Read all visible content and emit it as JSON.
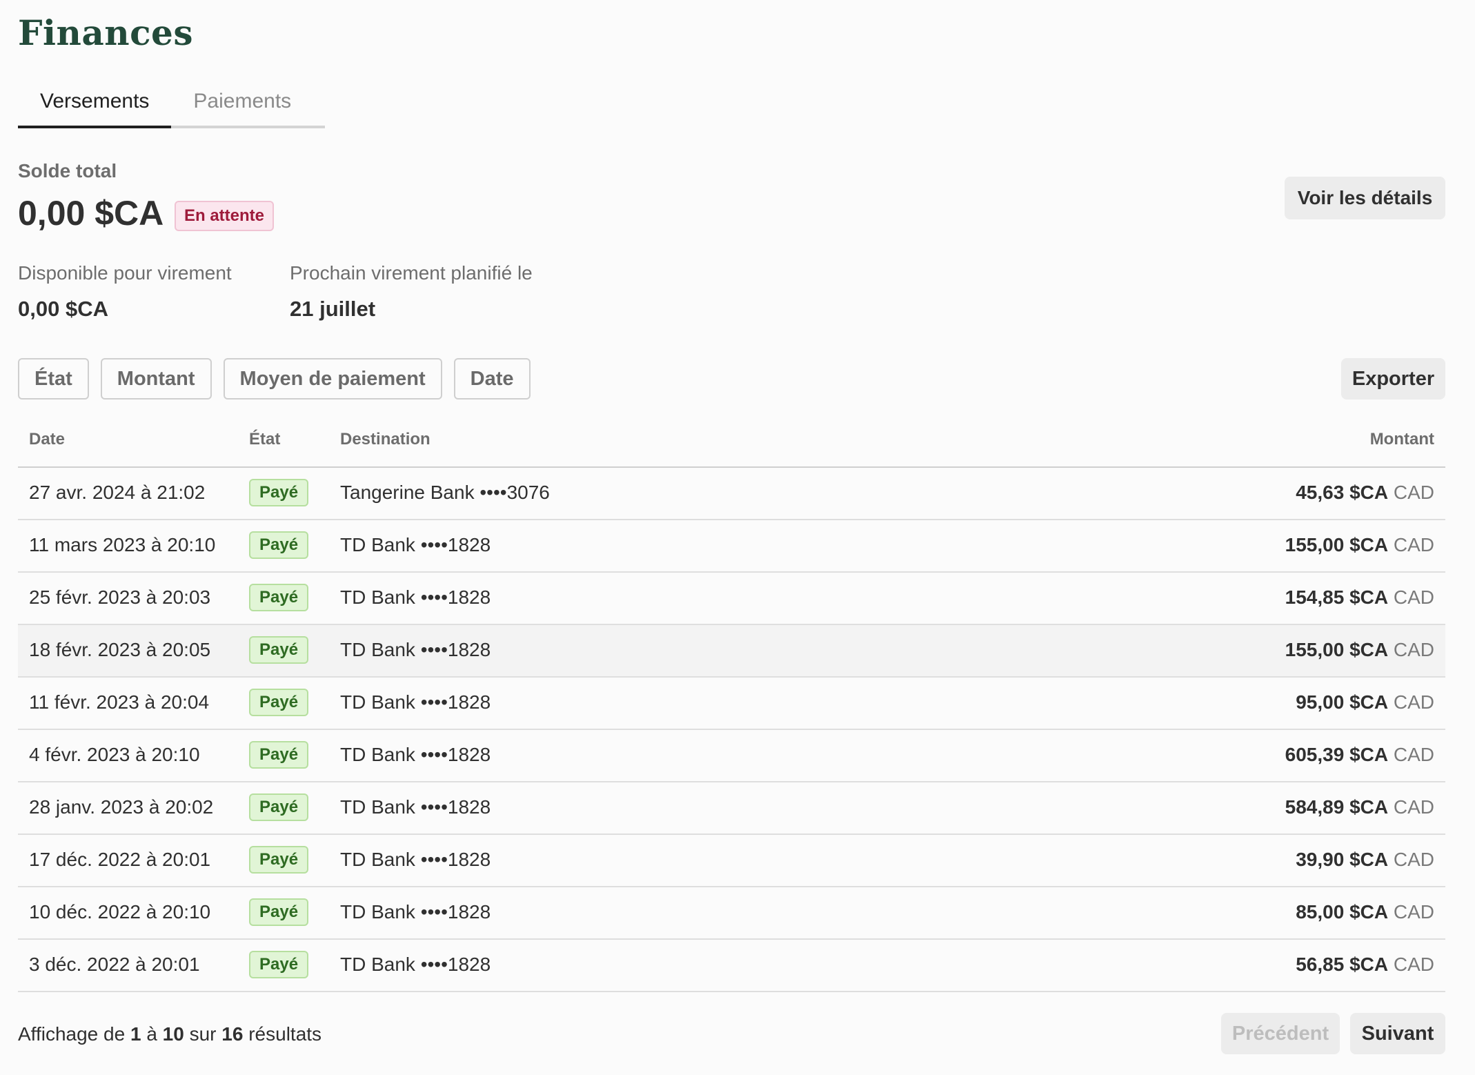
{
  "page_title": "Finances",
  "tabs": [
    {
      "label": "Versements",
      "active": true
    },
    {
      "label": "Paiements",
      "active": false
    }
  ],
  "balance": {
    "label": "Solde total",
    "value": "0,00 $CA",
    "status": "En attente",
    "details_button": "Voir les détails"
  },
  "stats": {
    "available_label": "Disponible pour virement",
    "available_value": "0,00 $CA",
    "next_label": "Prochain virement planifié le",
    "next_value": "21 juillet"
  },
  "filters": [
    "État",
    "Montant",
    "Moyen de paiement",
    "Date"
  ],
  "export_label": "Exporter",
  "table": {
    "columns": {
      "date": "Date",
      "status": "État",
      "destination": "Destination",
      "amount": "Montant"
    },
    "rows": [
      {
        "date": "27 avr. 2024 à 21:02",
        "status": "Payé",
        "destination": "Tangerine Bank ••••3076",
        "amount": "45,63 $CA",
        "currency": "CAD"
      },
      {
        "date": "11 mars 2023 à 20:10",
        "status": "Payé",
        "destination": "TD Bank ••••1828",
        "amount": "155,00 $CA",
        "currency": "CAD"
      },
      {
        "date": "25 févr. 2023 à 20:03",
        "status": "Payé",
        "destination": "TD Bank ••••1828",
        "amount": "154,85 $CA",
        "currency": "CAD"
      },
      {
        "date": "18 févr. 2023 à 20:05",
        "status": "Payé",
        "destination": "TD Bank ••••1828",
        "amount": "155,00 $CA",
        "currency": "CAD"
      },
      {
        "date": "11 févr. 2023 à 20:04",
        "status": "Payé",
        "destination": "TD Bank ••••1828",
        "amount": "95,00 $CA",
        "currency": "CAD"
      },
      {
        "date": "4 févr. 2023 à 20:10",
        "status": "Payé",
        "destination": "TD Bank ••••1828",
        "amount": "605,39 $CA",
        "currency": "CAD"
      },
      {
        "date": "28 janv. 2023 à 20:02",
        "status": "Payé",
        "destination": "TD Bank ••••1828",
        "amount": "584,89 $CA",
        "currency": "CAD"
      },
      {
        "date": "17 déc. 2022 à 20:01",
        "status": "Payé",
        "destination": "TD Bank ••••1828",
        "amount": "39,90 $CA",
        "currency": "CAD"
      },
      {
        "date": "10 déc. 2022 à 20:10",
        "status": "Payé",
        "destination": "TD Bank ••••1828",
        "amount": "85,00 $CA",
        "currency": "CAD"
      },
      {
        "date": "3 déc. 2022 à 20:01",
        "status": "Payé",
        "destination": "TD Bank ••••1828",
        "amount": "56,85 $CA",
        "currency": "CAD"
      }
    ]
  },
  "pagination": {
    "prefix": "Affichage de",
    "from": "1",
    "to_word": "à",
    "to": "10",
    "of_word": "sur",
    "total": "16",
    "suffix": "résultats",
    "prev_label": "Précédent",
    "next_label": "Suivant"
  }
}
